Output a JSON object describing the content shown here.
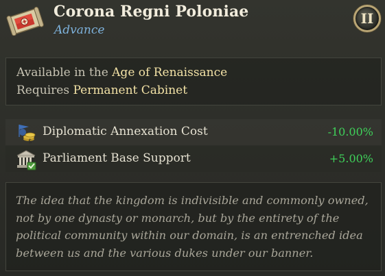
{
  "header": {
    "title": "Corona Regni Poloniae",
    "subtitle": "Advance",
    "icon": "scroll-flag-icon",
    "tier": "II"
  },
  "requirements": {
    "available_prefix": "Available in the ",
    "available_value": "Age of Renaissance",
    "requires_prefix": "Requires ",
    "requires_value": "Permanent Cabinet"
  },
  "modifiers": [
    {
      "icon": "diplomat-coins-icon",
      "label": "Diplomatic Annexation Cost",
      "value": "-10.00%"
    },
    {
      "icon": "parliament-building-icon",
      "label": "Parliament Base Support",
      "value": "+5.00%"
    }
  ],
  "description": "The idea that the kingdom is indivisible and commonly owned, not by one dynasty or monarch, but by the entirety of the political community within our domain, is an entrenched idea between us and the various dukes under our banner.",
  "colors": {
    "positive": "#3fd15a",
    "highlight": "#f3e2a6",
    "subtitle": "#7eb2dc",
    "badge_rim": "#b9a574"
  }
}
